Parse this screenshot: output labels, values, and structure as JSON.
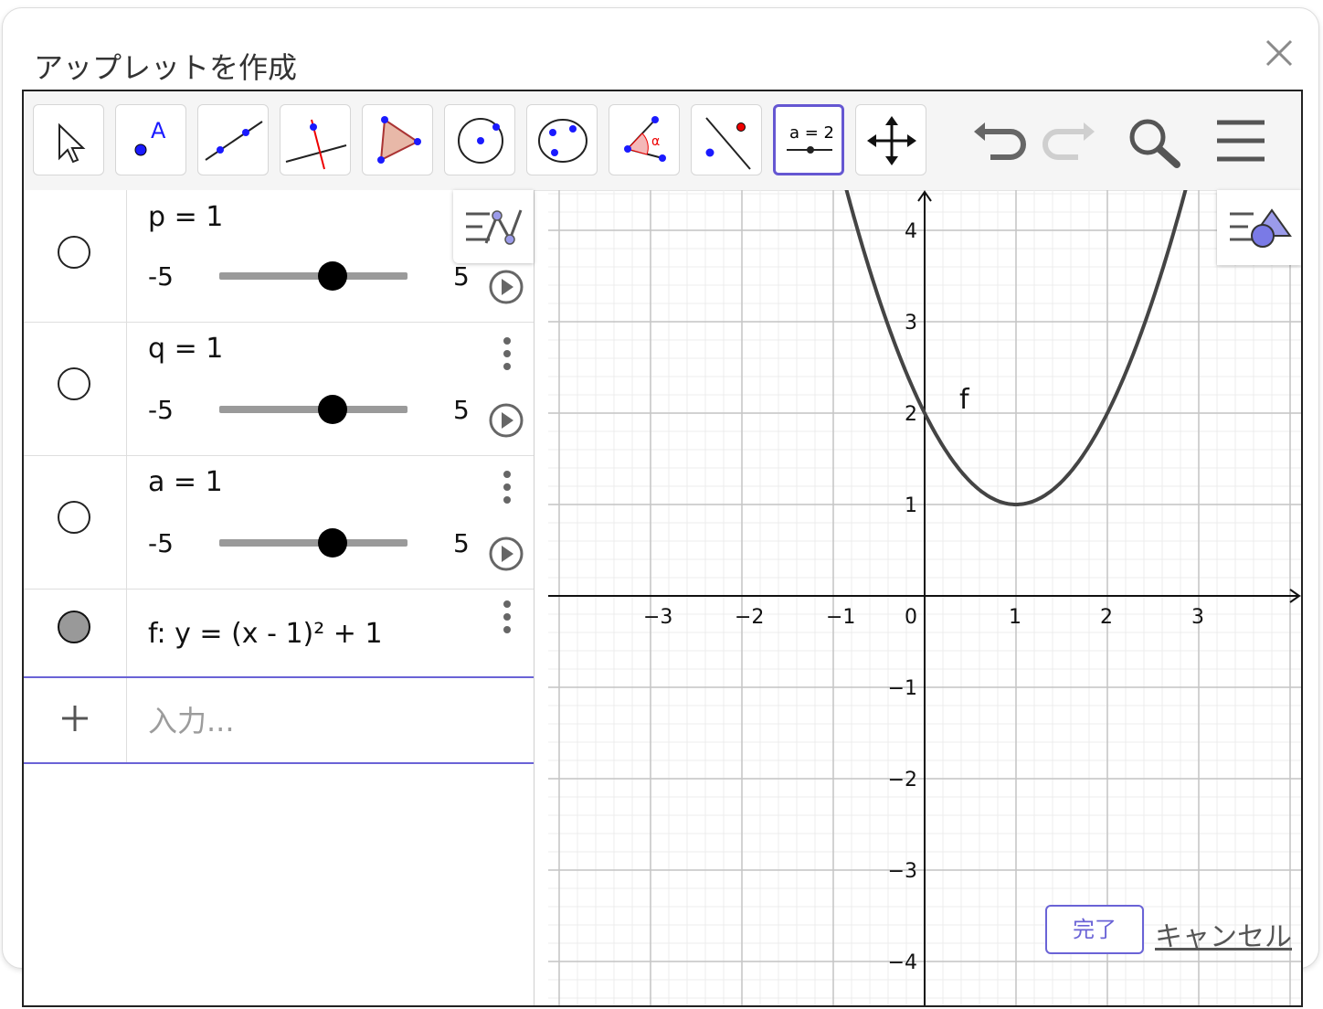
{
  "dialog": {
    "title": "アップレットを作成"
  },
  "toolbar": {
    "tools": [
      {
        "name": "move-tool-icon"
      },
      {
        "name": "point-tool-icon"
      },
      {
        "name": "line-tool-icon"
      },
      {
        "name": "perpendicular-line-tool-icon"
      },
      {
        "name": "polygon-tool-icon"
      },
      {
        "name": "circle-tool-icon"
      },
      {
        "name": "conic-tool-icon"
      },
      {
        "name": "angle-tool-icon"
      },
      {
        "name": "reflect-tool-icon"
      },
      {
        "name": "slider-tool-icon",
        "selected": true,
        "label": "a = 2"
      },
      {
        "name": "move-graphics-view-icon"
      }
    ],
    "undo": "undo-icon",
    "redo": "redo-icon",
    "search": "search-icon",
    "menu": "menu-icon"
  },
  "algebra": {
    "sliders": [
      {
        "equation": "p = 1",
        "min": "-5",
        "max": "5",
        "value": 1,
        "range": [
          -5,
          5
        ]
      },
      {
        "equation": "q = 1",
        "min": "-5",
        "max": "5",
        "value": 1,
        "range": [
          -5,
          5
        ]
      },
      {
        "equation": "a = 1",
        "min": "-5",
        "max": "5",
        "value": 1,
        "range": [
          -5,
          5
        ]
      }
    ],
    "function": {
      "equation": "f: y = (x - 1)² + 1"
    },
    "input": {
      "placeholder": "入力..."
    }
  },
  "graph": {
    "x_ticks": [
      "−3",
      "−2",
      "−1",
      "0",
      "1",
      "2",
      "3"
    ],
    "y_ticks": [
      "4",
      "3",
      "2",
      "1",
      "−1",
      "−2",
      "−3",
      "−4"
    ],
    "curve_label": "f",
    "function": {
      "a": 1,
      "p": 1,
      "q": 1
    },
    "x_range": [
      -4.1,
      4.1
    ],
    "y_range": [
      -4.45,
      4.45
    ]
  },
  "footer": {
    "done": "完了",
    "cancel": "キャンセル"
  }
}
